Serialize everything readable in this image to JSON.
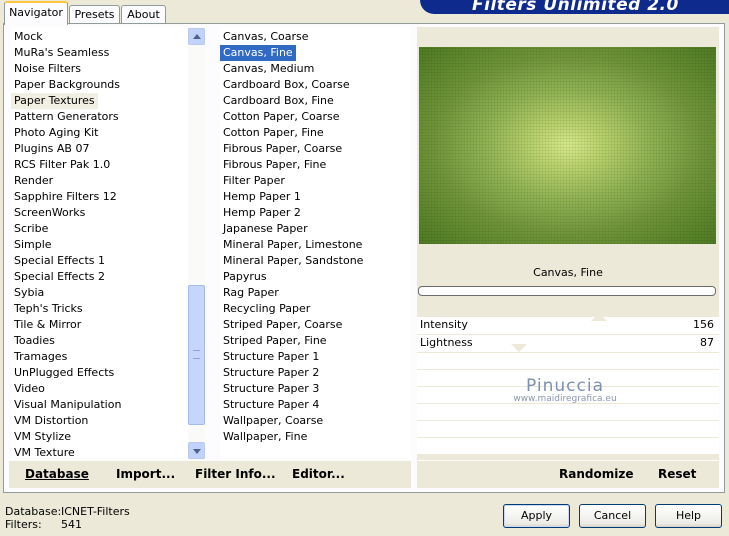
{
  "banner": {
    "title": "Filters Unlimited 2.0"
  },
  "tabs": [
    {
      "label": "Navigator",
      "active": true
    },
    {
      "label": "Presets",
      "active": false
    },
    {
      "label": "About",
      "active": false
    }
  ],
  "categories": [
    "Mock",
    "MuRa's Seamless",
    "Noise Filters",
    "Paper Backgrounds",
    "Paper Textures",
    "Pattern Generators",
    "Photo Aging Kit",
    "Plugins AB 07",
    "RCS Filter Pak 1.0",
    "Render",
    "Sapphire Filters 12",
    "ScreenWorks",
    "Scribe",
    "Simple",
    "Special Effects 1",
    "Special Effects 2",
    "Sybia",
    "Teph's Tricks",
    "Tile & Mirror",
    "Toadies",
    "Tramages",
    "UnPlugged Effects",
    "Video",
    "Visual Manipulation",
    "VM Distortion",
    "VM Stylize",
    "VM Texture"
  ],
  "selected_category": "Paper Textures",
  "filters": [
    "Canvas, Coarse",
    "Canvas, Fine",
    "Canvas, Medium",
    "Cardboard Box, Coarse",
    "Cardboard Box, Fine",
    "Cotton Paper, Coarse",
    "Cotton Paper, Fine",
    "Fibrous Paper, Coarse",
    "Fibrous Paper, Fine",
    "Filter Paper",
    "Hemp Paper 1",
    "Hemp Paper 2",
    "Japanese Paper",
    "Mineral Paper, Limestone",
    "Mineral Paper, Sandstone",
    "Papyrus",
    "Rag Paper",
    "Recycling Paper",
    "Striped Paper, Coarse",
    "Striped Paper, Fine",
    "Structure Paper 1",
    "Structure Paper 2",
    "Structure Paper 3",
    "Structure Paper 4",
    "Wallpaper, Coarse",
    "Wallpaper, Fine"
  ],
  "selected_filter": "Canvas, Fine",
  "toolbar": {
    "database": "Database",
    "import": "Import...",
    "filter_info": "Filter Info...",
    "editor": "Editor...",
    "randomize": "Randomize",
    "reset": "Reset"
  },
  "preview": {
    "filter_name": "Canvas, Fine",
    "colors": {
      "center": "#d6e88a",
      "edge": "#4d7a22"
    }
  },
  "sliders": [
    {
      "label": "Intensity",
      "value": "156",
      "level": 0.61
    },
    {
      "label": "Lightness",
      "value": "87",
      "level": 0.34
    }
  ],
  "watermark": {
    "name": "Pinuccia",
    "url": "www.maidiregrafica.eu"
  },
  "status": {
    "database_label": "Database:",
    "database_value": "ICNET-Filters",
    "filters_label": "Filters:",
    "filters_value": "541"
  },
  "buttons": {
    "apply": "Apply",
    "cancel": "Cancel",
    "help": "Help"
  }
}
